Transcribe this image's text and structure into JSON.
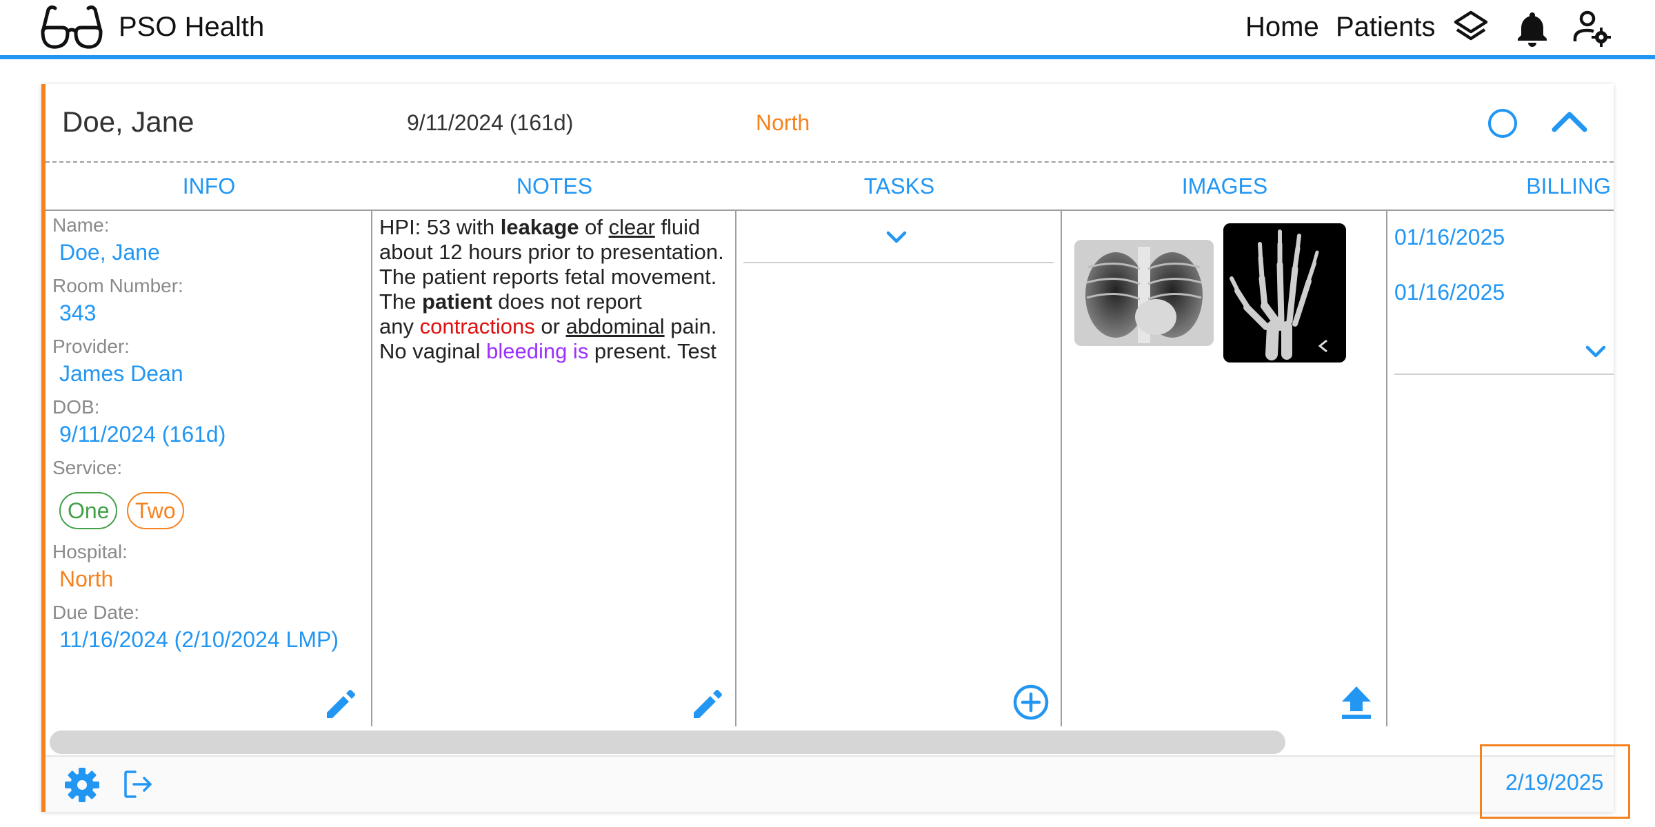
{
  "app": {
    "title": "PSO Health",
    "nav": {
      "home": "Home",
      "patients": "Patients"
    }
  },
  "icons": {
    "logo": "glasses-icon",
    "layers": "layers-icon",
    "notifications": "bell-icon",
    "account": "user-settings-icon",
    "status": "circle-outline-icon",
    "collapse": "chevron-up-icon",
    "edit": "pencil-icon",
    "add": "plus-circle-icon",
    "upload": "upload-icon",
    "settings": "gear-icon",
    "logout": "logout-icon"
  },
  "colors": {
    "accent": "#2196f3",
    "orange": "#f5821f",
    "green": "#43a047",
    "red": "#e01010",
    "purple": "#9b30ff"
  },
  "card": {
    "patient_name": "Doe, Jane",
    "dob": "9/11/2024 (161d)",
    "hospital": "North"
  },
  "tabs": [
    "INFO",
    "NOTES",
    "TASKS",
    "IMAGES",
    "BILLING"
  ],
  "info": {
    "name_label": "Name:",
    "name_value": "Doe, Jane",
    "room_label": "Room Number:",
    "room_value": "343",
    "provider_label": "Provider:",
    "provider_value": "James Dean",
    "dob_label": "DOB:",
    "dob_value": "9/11/2024 (161d)",
    "service_label": "Service:",
    "services": [
      "One",
      "Two"
    ],
    "hospital_label": "Hospital:",
    "hospital_value": "North",
    "due_label": "Due Date:",
    "due_value": "11/16/2024 (2/10/2024 LMP)"
  },
  "notes": {
    "segments": [
      "HPI: 53 with ",
      "leakage",
      " of ",
      "clear",
      " fluid about 12 hours prior to presentation. The patient reports fetal movement. The ",
      "patient",
      " does not report",
      "any ",
      "contractions",
      " or ",
      "abdominal",
      " pain. No vaginal ",
      "bleeding is",
      " present. Test"
    ]
  },
  "images": [
    {
      "name": "chest-xray"
    },
    {
      "name": "hand-xray"
    }
  ],
  "billing": {
    "dates": [
      "01/16/2025",
      "01/16/2025"
    ]
  },
  "footer": {
    "date": "2/19/2025"
  }
}
